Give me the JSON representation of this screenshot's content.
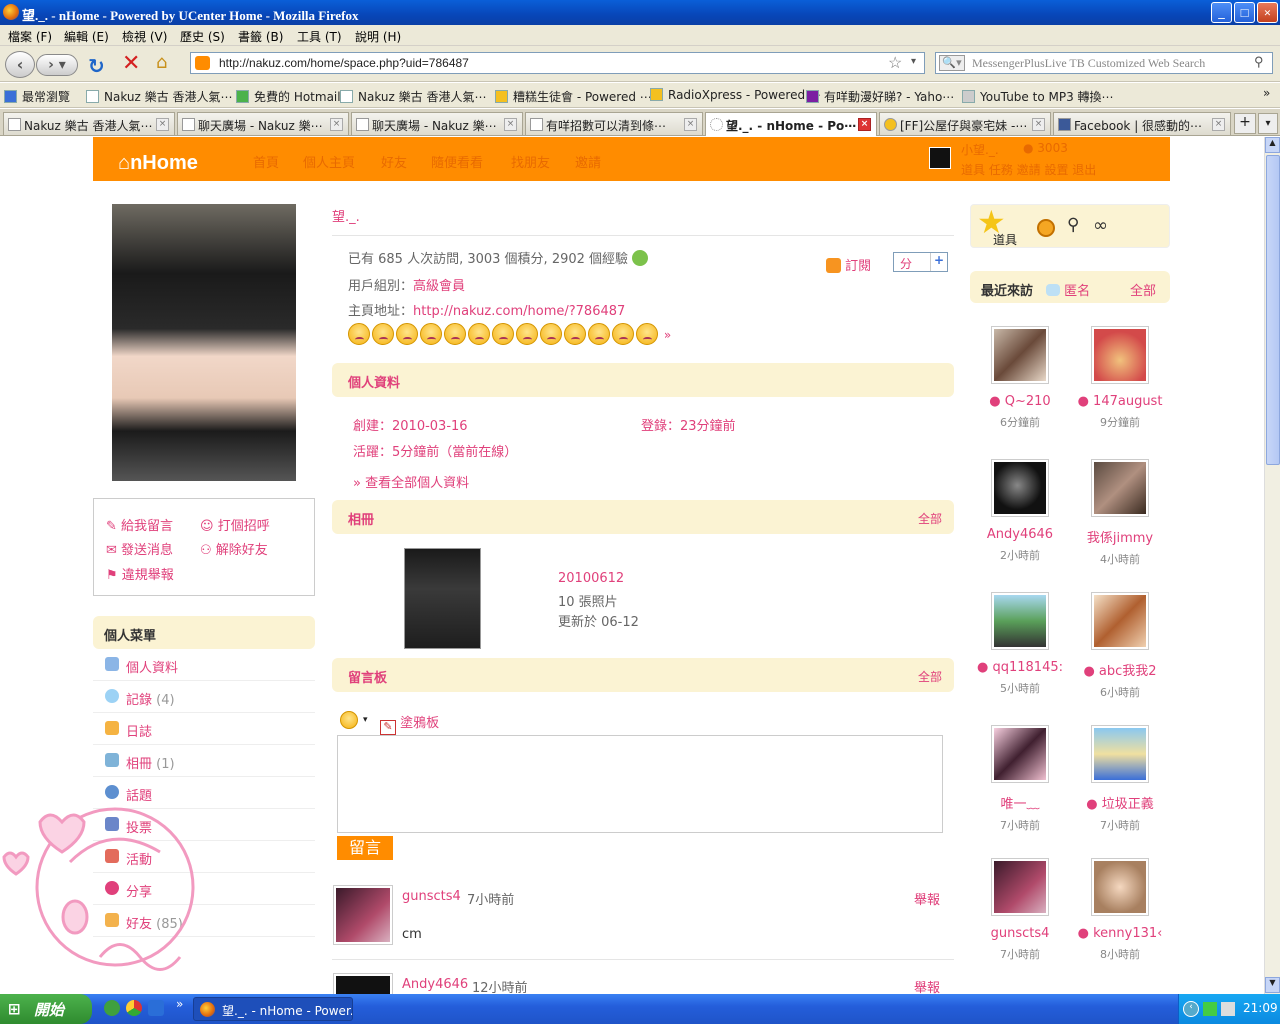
{
  "window": {
    "title": "望._. - nHome - Powered by UCenter Home - Mozilla Firefox",
    "min": "_",
    "max": "□",
    "close": "×"
  },
  "menubar": [
    "檔案 (F)",
    "編輯 (E)",
    "檢視 (V)",
    "歷史 (S)",
    "書籤 (B)",
    "工具 (T)",
    "說明 (H)"
  ],
  "nav": {
    "url": "http://nakuz.com/home/space.php?uid=786487",
    "search_placeholder": "MessengerPlusLive TB Customized Web Search"
  },
  "bookmarks": [
    "最常瀏覽",
    "Nakuz 樂古 香港人氣⋯",
    "免費的 Hotmail",
    "Nakuz 樂古 香港人氣⋯",
    "糟糕生徒會 - Powered ⋯",
    "RadioXpress - Powered ⋯",
    "有咩動漫好睇? - Yaho⋯",
    "YouTube to MP3 轉換⋯"
  ],
  "tabs": [
    {
      "label": "Nakuz 樂古 香港人氣⋯"
    },
    {
      "label": "聊天廣場 - Nakuz 樂⋯"
    },
    {
      "label": "聊天廣場 - Nakuz 樂⋯"
    },
    {
      "label": "有咩招數可以清到條⋯"
    },
    {
      "label": "望._. - nHome - Po⋯"
    },
    {
      "label": "[FF]公屋仔與豪宅妹 -⋯"
    },
    {
      "label": "Facebook | 很感動的⋯"
    }
  ],
  "site": {
    "logo": "nHome",
    "nav": [
      "首頁",
      "個人主頁",
      "好友",
      "隨便看看",
      "找朋友",
      "邀請"
    ],
    "user": {
      "name": "小望._.",
      "credits": "3003",
      "links": "道具 任務 邀請 設置 退出"
    }
  },
  "profile": {
    "name": "望._.",
    "stats": "已有 685 人次訪問, 3003 個積分, 2902 個經驗",
    "group_label": "用戶組別：",
    "group": "高級會員",
    "home_label": "主頁地址：",
    "home_url": "http://nakuz.com/home/?786487",
    "more_arrow": "»",
    "subscribe": "訂閱",
    "share": "分",
    "add": "+"
  },
  "info": {
    "title": "個人資料",
    "created": "創建：2010-03-16",
    "login": "登錄：23分鐘前",
    "active": "活躍：5分鐘前（當前在線）",
    "more": "» 查看全部個人資料"
  },
  "album": {
    "title": "相冊",
    "all": "全部",
    "name": "20100612",
    "count": "10 張照片",
    "updated": "更新於 06-12"
  },
  "board": {
    "title": "留言板",
    "all": "全部",
    "graffiti": "塗鴉板",
    "submit": "留言"
  },
  "comments": [
    {
      "user": "gunscts4",
      "time": "7小時前",
      "text": "cm",
      "report": "舉報"
    },
    {
      "user": "Andy4646",
      "time": "12小時前",
      "text": "",
      "report": "舉報"
    }
  ],
  "actions": [
    {
      "label": "給我留言"
    },
    {
      "label": "打個招呼"
    },
    {
      "label": "發送消息"
    },
    {
      "label": "解除好友"
    },
    {
      "label": "違規舉報"
    }
  ],
  "menu": {
    "title": "個人菜單",
    "items": [
      {
        "label": "個人資料",
        "count": ""
      },
      {
        "label": "記錄",
        "count": "(4)"
      },
      {
        "label": "日誌",
        "count": ""
      },
      {
        "label": "相冊",
        "count": "(1)"
      },
      {
        "label": "話題",
        "count": ""
      },
      {
        "label": "投票",
        "count": ""
      },
      {
        "label": "活動",
        "count": ""
      },
      {
        "label": "分享",
        "count": ""
      },
      {
        "label": "好友",
        "count": "(85)"
      }
    ]
  },
  "right": {
    "tools_label": "道具",
    "visitors_title": "最近來訪",
    "anon": "匿名",
    "all": "全部",
    "visitors": [
      {
        "name": "Q~210",
        "time": "6分鐘前"
      },
      {
        "name": "147august",
        "time": "9分鐘前"
      },
      {
        "name": "Andy4646",
        "time": "2小時前"
      },
      {
        "name": "我係jimmy",
        "time": "4小時前"
      },
      {
        "name": "qq118145:",
        "time": "5小時前"
      },
      {
        "name": "abc我我2",
        "time": "6小時前"
      },
      {
        "name": "唯一﹏",
        "time": "7小時前"
      },
      {
        "name": "垃圾正義",
        "time": "7小時前"
      },
      {
        "name": "gunscts4",
        "time": "7小時前"
      },
      {
        "name": "kenny131‹",
        "time": "8小時前"
      }
    ]
  },
  "taskbar": {
    "start": "開始",
    "window": "望._. - nHome - Power...",
    "clock": "21:09",
    "quick": "»"
  },
  "colors": {
    "accent": "#ff8c00",
    "link": "#e0407b",
    "section_bg": "#fbf3d3"
  }
}
